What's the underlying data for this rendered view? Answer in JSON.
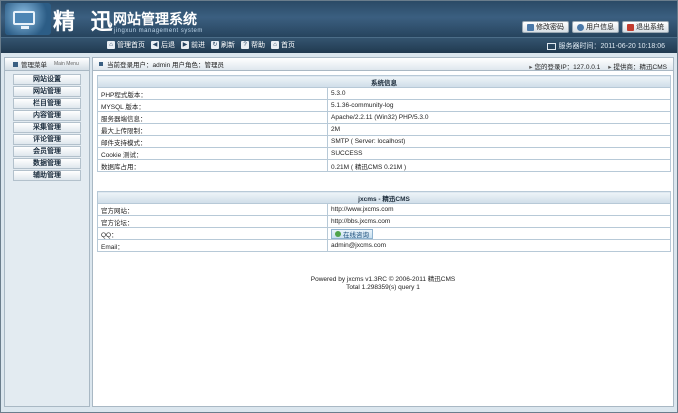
{
  "header": {
    "brand_cn": "精 迅",
    "title": "网站管理系统",
    "subtitle": "jingxun management system",
    "buttons": [
      "修改密码",
      "用户信息",
      "退出系统"
    ]
  },
  "nav": {
    "items": [
      "管理首页",
      "后退",
      "前进",
      "刷新",
      "帮助",
      "首页"
    ],
    "server_time": "服务器时间：2011-06-20 10:18:06"
  },
  "sidebar": {
    "title": "管理菜单",
    "title_en": "Main Menu",
    "items": [
      "网站设置",
      "网站管理",
      "栏目管理",
      "内容管理",
      "采集管理",
      "评论管理",
      "会员管理",
      "数据管理",
      "辅助管理"
    ]
  },
  "main": {
    "current_user": "当前登录用户：admin  用户角色：管理员",
    "last_ip": "您的登录IP：127.0.0.1",
    "provider": "提供商：精迅CMS"
  },
  "system_info": {
    "title": "系统信息",
    "rows": [
      {
        "label": "PHP程式版本：",
        "value": "5.3.0"
      },
      {
        "label": "MYSQL 版本：",
        "value": "5.1.36-community-log"
      },
      {
        "label": "服务器端信息：",
        "value": "Apache/2.2.11 (Win32) PHP/5.3.0"
      },
      {
        "label": "最大上传限制：",
        "value": "2M"
      },
      {
        "label": "邮件支持模式：",
        "value": "SMTP ( Server: localhost)"
      },
      {
        "label": "Cookie 测试：",
        "value": "SUCCESS"
      },
      {
        "label": "数据库占用：",
        "value": "0.21M ( 精迅CMS 0.21M )"
      }
    ]
  },
  "cms_info": {
    "title": "jxcms - 精迅CMS",
    "rows": [
      {
        "label": "官方网站：",
        "value": "http://www.jxcms.com"
      },
      {
        "label": "官方论坛：",
        "value": "http://bbs.jxcms.com"
      },
      {
        "label": "QQ：",
        "value": "在线咨询"
      },
      {
        "label": "Email：",
        "value": "admin@jxcms.com"
      }
    ]
  },
  "footer": {
    "line1": "Powered by jxcms v1.3RC © 2006-2011 精迅CMS",
    "line2": "Total 1.298359(s) query 1"
  }
}
